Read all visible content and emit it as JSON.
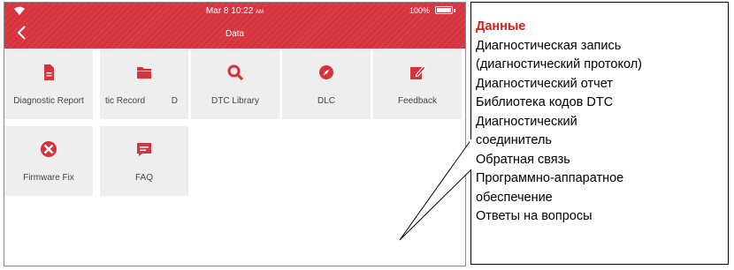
{
  "status_bar": {
    "time": "Mar 8 10:22",
    "ampm": "AM",
    "battery_percent": "100%",
    "battery_level": 1.0
  },
  "header": {
    "title": "Data",
    "back_icon": "chevron-left-icon"
  },
  "tiles": [
    {
      "label": "Diagnostic Report",
      "icon": "document-icon"
    },
    {
      "label": "tic Record",
      "label2": "D",
      "icon": "folder-icon"
    },
    {
      "label": "DTC Library",
      "icon": "magnifier-icon"
    },
    {
      "label": "DLC",
      "icon": "compass-icon"
    },
    {
      "label": "Feedback",
      "icon": "edit-icon"
    },
    {
      "label": "Firmware Fix",
      "icon": "wrench-screwdriver-icon"
    },
    {
      "label": "FAQ",
      "icon": "chat-icon"
    }
  ],
  "callout": {
    "heading": "Данные",
    "lines": [
      "Диагностическая запись",
      "(диагностический протокол)",
      "Диагностический отчет",
      "Библиотека кодов DTC",
      "Диагностический",
      "соединитель",
      "Обратная связь",
      "Программно-аппаратное",
      "обеспечение",
      "Ответы на вопросы"
    ]
  },
  "colors": {
    "header_red": "#d7333e",
    "icon_red": "#d7333e",
    "tile_gray": "#eeeeee",
    "callout_heading": "#e41b17"
  }
}
